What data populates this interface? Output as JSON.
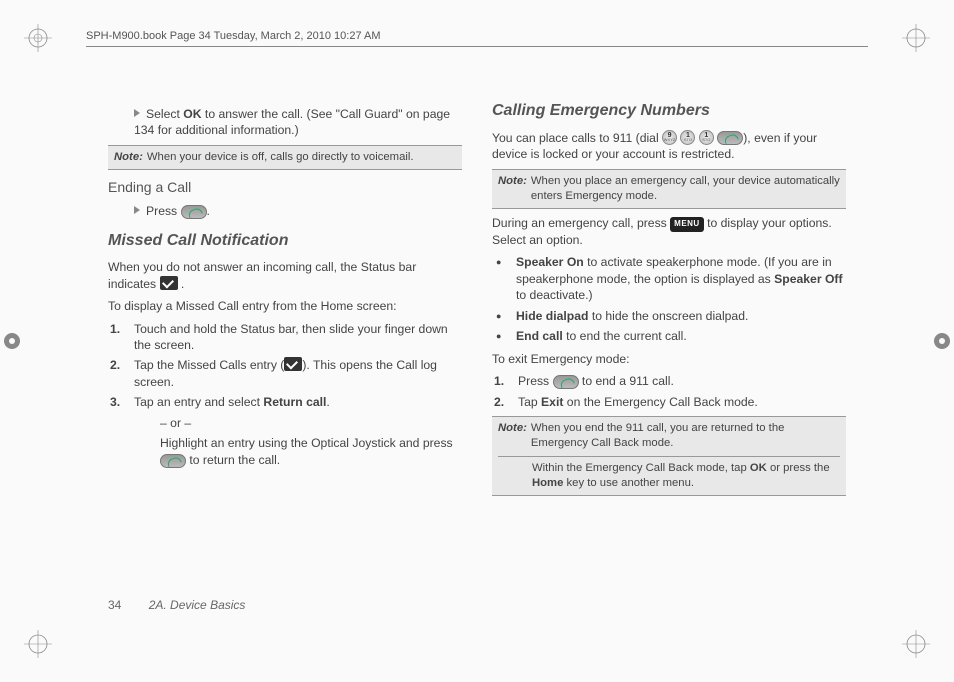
{
  "header": {
    "running": "SPH-M900.book  Page 34  Tuesday, March 2, 2010  10:27 AM"
  },
  "left": {
    "intro_prefix": "Select ",
    "intro_bold": "OK",
    "intro_suffix": " to answer the call. (See \"Call Guard\" on page 134 for additional information.)",
    "note1": "When your device is off, calls go directly to voicemail.",
    "ending_head": "Ending a Call",
    "ending_text": "Press ",
    "missed_head": "Missed Call Notification",
    "missed_p1": "When you do not answer an incoming call, the Status bar indicates ",
    "missed_p2": "To display a Missed Call entry from the Home screen:",
    "step1": "Touch and hold the Status bar, then slide your finger down the screen.",
    "step2_a": "Tap the Missed Calls entry (",
    "step2_b": "). This opens the Call log screen.",
    "step3_a": "Tap an entry and select ",
    "step3_bold": "Return call",
    "step3_b": ".",
    "or": "– or –",
    "step3_c": "Highlight an entry using the Optical Joystick and press ",
    "step3_d": " to return the call."
  },
  "right": {
    "head": "Calling Emergency Numbers",
    "p1_a": "You can place calls to 911 (dial ",
    "p1_b": "), even if your device is locked or your account is restricted.",
    "note2": "When you place an emergency call, your device automatically enters Emergency mode.",
    "p2_a": "During an emergency call, press ",
    "p2_b": " to display your options. Select an option.",
    "b1_bold": "Speaker On",
    "b1": " to activate speakerphone mode. (If you are in speakerphone mode, the option is displayed as ",
    "b1_bold2": "Speaker Off",
    "b1_end": " to deactivate.)",
    "b2_bold": "Hide dialpad",
    "b2": " to hide the onscreen dialpad.",
    "b3_bold": "End call",
    "b3": " to end the current call.",
    "exit_head": "To exit Emergency mode:",
    "s1_a": "Press ",
    "s1_b": " to end a 911 call.",
    "s2_a": "Tap ",
    "s2_bold": "Exit",
    "s2_b": " on the Emergency Call Back mode.",
    "note3a": "When you end the 911 call, you are returned to the Emergency Call Back mode.",
    "note3b_a": "Within the Emergency Call Back mode, tap ",
    "note3b_bold1": "OK",
    "note3b_mid": " or press the ",
    "note3b_bold2": "Home",
    "note3b_end": " key to use another menu."
  },
  "footer": {
    "page": "34",
    "section": "2A. Device Basics"
  },
  "labels": {
    "note": "Note:",
    "menu": "MENU"
  },
  "keys": {
    "k9": "9",
    "k9s": "WXYZ",
    "k1": "1",
    "k1s": "STO"
  }
}
